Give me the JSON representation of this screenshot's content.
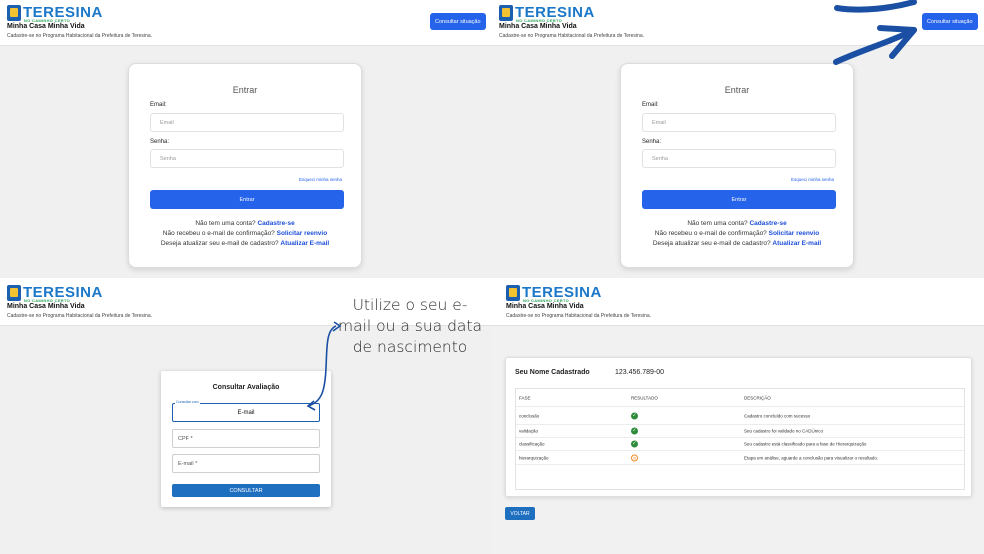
{
  "brand": {
    "logo_word": "TERESINA",
    "logo_tag": "NO CAMINHO CERTO",
    "app_title": "Minha Casa Minha Vida",
    "app_subtitle": "Cadastre-se no Programa Habitacional da Prefeitura de Teresina."
  },
  "header": {
    "consult_button": "Consultar situação"
  },
  "login": {
    "title": "Entrar",
    "email_label": "Email:",
    "email_placeholder": "Email",
    "password_label": "Senha:",
    "password_placeholder": "Senha",
    "forgot": "Esqueci minha senha",
    "submit": "Entrar",
    "line1_text": "Não tem uma conta?",
    "line1_link": "Cadastre-se",
    "line2_text": "Não recebeu o e-mail de confirmação?",
    "line2_link": "Solicitar reenvio",
    "line3_text": "Deseja atualizar seu e-mail de cadastro?",
    "line3_link": "Atualizar E-mail"
  },
  "evaluation": {
    "title": "Consultar Avaliação",
    "select_legend": "Consultar com",
    "select_value": "E-mail",
    "cpf_label": "CPF *",
    "email_label": "E-mail *",
    "submit": "CONSULTAR"
  },
  "callout": {
    "text": "Utilize o seu e-mail ou a sua data de nascimento"
  },
  "result": {
    "name": "Seu Nome Cadastrado",
    "cpf": "123.456.789-00",
    "columns": [
      "FASE",
      "RESULTADO",
      "DESCRIÇÃO"
    ],
    "rows": [
      {
        "phase": "conclusão",
        "status": "ok",
        "description": "Cadastro concluído com sucesso"
      },
      {
        "phase": "validação",
        "status": "ok",
        "description": "Seu cadastro foi validado no CADÚnico"
      },
      {
        "phase": "classificação",
        "status": "ok",
        "description": "Seu cadastro está classificado para a fase de Hierarquização"
      },
      {
        "phase": "hierarquização",
        "status": "pending",
        "description": "Etapa em análise, aguarde a conclusão para visualizar o resultado."
      }
    ],
    "back_button": "VOLTAR"
  },
  "colors": {
    "primary": "#2563eb",
    "secondary": "#1f6fc1",
    "arrow": "#1b4fa3",
    "ok": "#2e8b3a",
    "pending": "#f08a24"
  }
}
